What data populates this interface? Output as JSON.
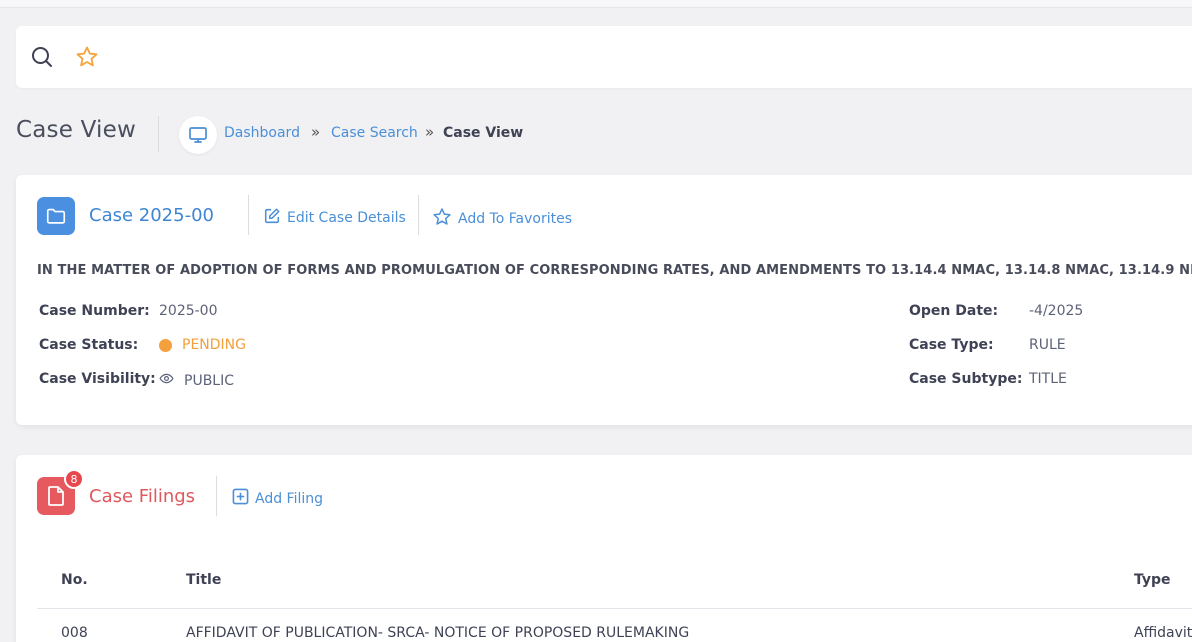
{
  "search": {
    "search_icon": "search-icon",
    "favorite_icon": "star-icon",
    "favorite_color": "#f5a33a"
  },
  "header": {
    "title": "Case View",
    "breadcrumb": {
      "icon": "monitor-icon",
      "items": [
        {
          "label": "Dashboard"
        },
        {
          "label": "Case Search"
        },
        {
          "label": "Case View"
        }
      ],
      "separator": "»"
    }
  },
  "case": {
    "title": "Case 2025-00   ",
    "folder_icon": "folder-icon",
    "edit_label": "Edit Case Details",
    "favorites_label": "Add To Favorites",
    "description": "IN THE MATTER OF ADOPTION OF FORMS AND PROMULGATION OF CORRESPONDING RATES, AND AMENDMENTS TO 13.14.4 NMAC, 13.14.8 NMAC, 13.14.9 NMA",
    "fields_left": [
      {
        "label": "Case Number:",
        "value": "2025-00"
      },
      {
        "label": "Case Status:",
        "value": "PENDING"
      },
      {
        "label": "Case Visibility:",
        "value": "PUBLIC"
      }
    ],
    "fields_right": [
      {
        "label": "Open Date:",
        "value": "-4/2025"
      },
      {
        "label": "Case Type:",
        "value": "RULE"
      },
      {
        "label": "Case Subtype:",
        "value": "TITLE"
      }
    ],
    "status_color": "#f4a03d"
  },
  "filings": {
    "title": "Case Filings",
    "count": "8",
    "file_icon": "file-icon",
    "add_label": "Add Filing",
    "columns": [
      "No.",
      "Title",
      "Type"
    ],
    "rows": [
      {
        "no": "008",
        "title": "AFFIDAVIT OF PUBLICATION- SRCA- NOTICE OF PROPOSED RULEMAKING",
        "type": "Affidavit"
      }
    ]
  },
  "colors": {
    "link": "#4a8fd8",
    "accent_blue": "#4b90e0",
    "accent_red": "#e65a5f"
  }
}
